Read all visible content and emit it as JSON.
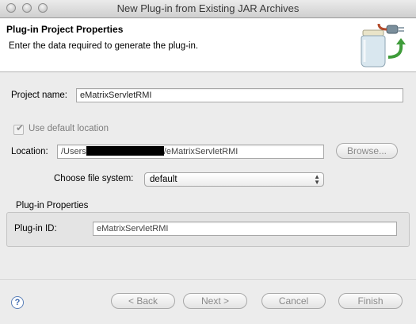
{
  "window": {
    "title": "New Plug-in from Existing JAR Archives"
  },
  "banner": {
    "title": "Plug-in Project Properties",
    "description": "Enter the data required to generate the plug-in.",
    "icon": "jar-plugin-wizard-icon"
  },
  "form": {
    "project_name_label": "Project name:",
    "project_name_value": "eMatrixServletRMI",
    "use_default_location_label": "Use default location",
    "use_default_location_checked": true,
    "location_label": "Location:",
    "location_prefix": "/Users",
    "location_suffix": "/eMatrixServletRMI",
    "browse_label": "Browse...",
    "file_system_label": "Choose file system:",
    "file_system_value": "default"
  },
  "plugin_properties": {
    "group_label": "Plug-in Properties",
    "plugin_id_label": "Plug-in ID:",
    "plugin_id_value": "eMatrixServletRMI"
  },
  "buttons": {
    "help": "?",
    "back": "< Back",
    "next": "Next >",
    "cancel": "Cancel",
    "finish": "Finish"
  },
  "colors": {
    "help_accent": "#3c68ae",
    "dialog_bg": "#ececec"
  }
}
